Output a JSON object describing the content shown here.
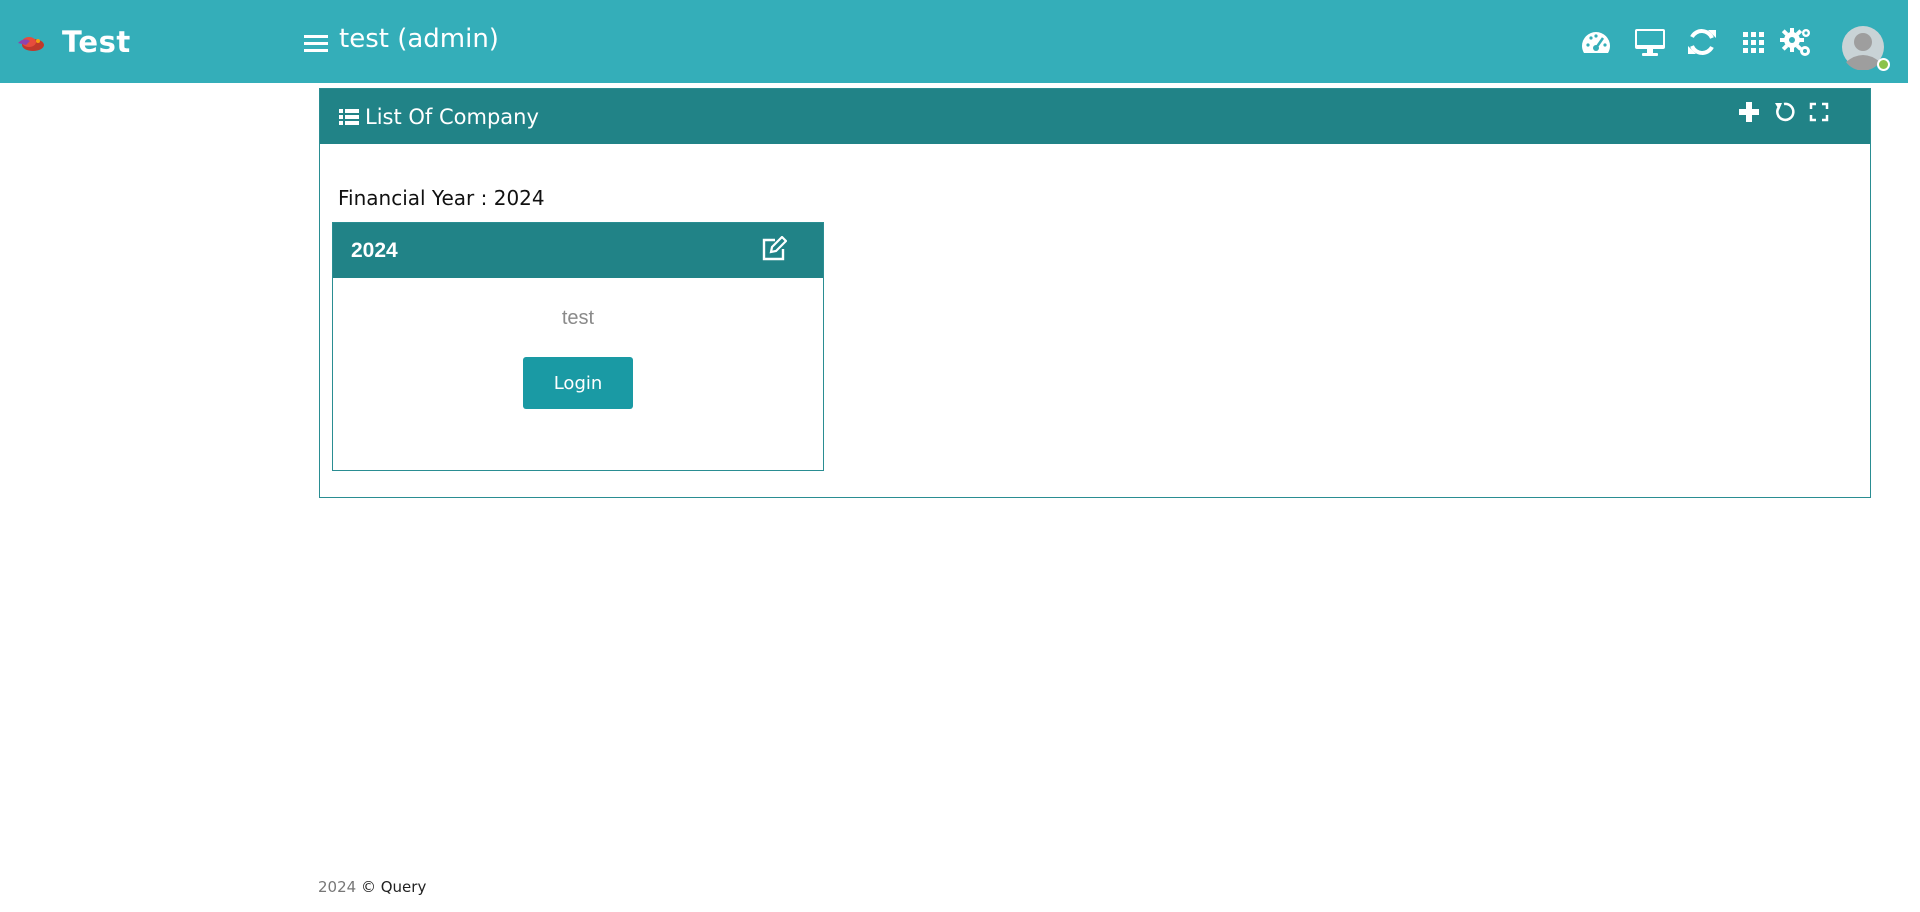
{
  "header": {
    "brand_name": "Test",
    "user_title": "test (admin)",
    "icons": [
      "dashboard-icon",
      "monitor-icon",
      "refresh-icon",
      "apps-grid-icon",
      "settings-icon",
      "user-avatar-icon"
    ],
    "background_color": "#34aeb9"
  },
  "panel": {
    "title": "List Of Company",
    "header_color": "#218387",
    "tools": [
      "add-icon",
      "reload-icon",
      "fullscreen-icon"
    ]
  },
  "financial_year": {
    "label": "Financial Year : 2024"
  },
  "card": {
    "year": "2024",
    "company": "test",
    "login_label": "Login",
    "button_color": "#1a9aa4"
  },
  "footer": {
    "year": "2024",
    "text": "© Query"
  }
}
